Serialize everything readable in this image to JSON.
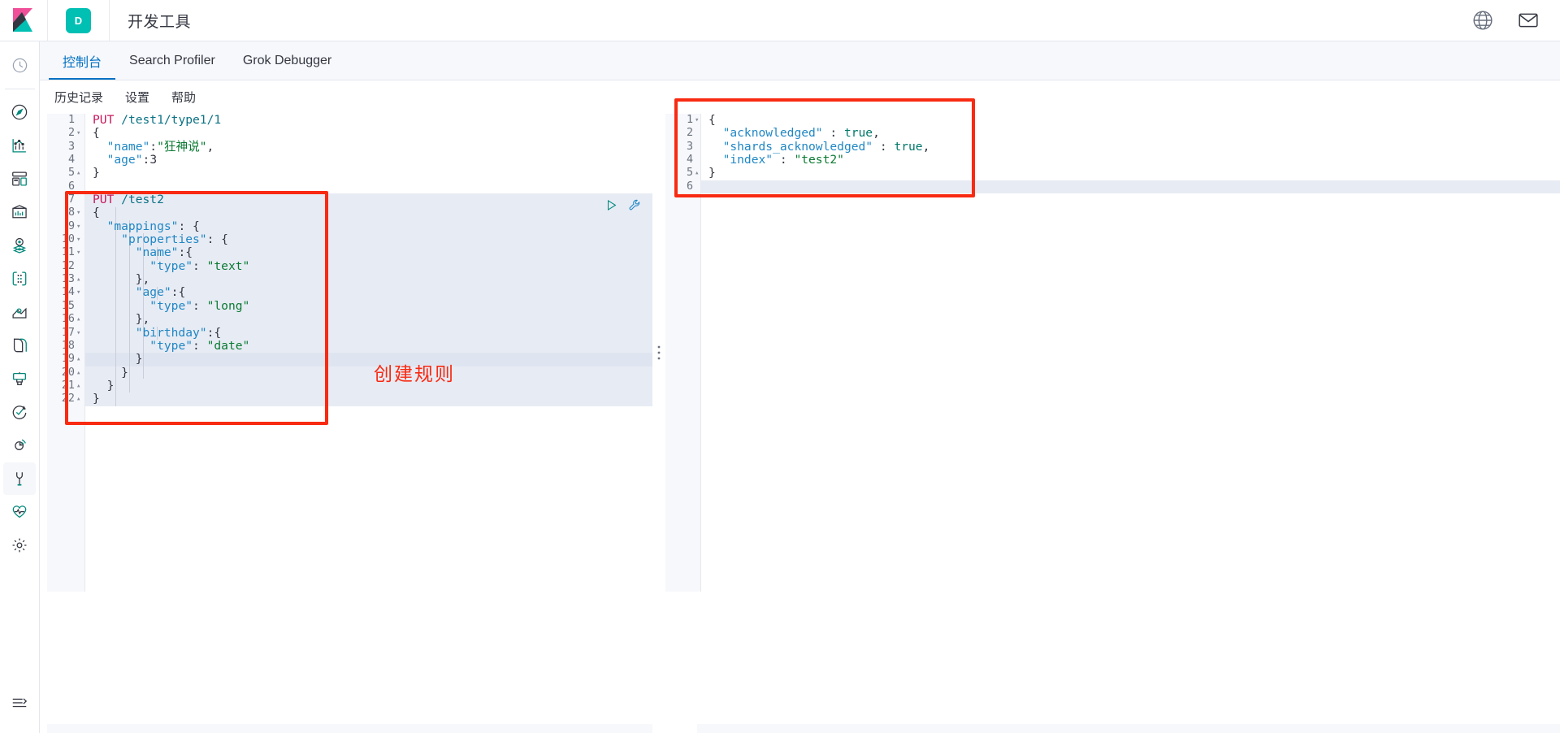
{
  "header": {
    "logo_name": "kibana-logo",
    "space_badge": "D",
    "app_title": "开发工具",
    "icons": [
      {
        "name": "help-icon",
        "label": "help"
      },
      {
        "name": "mail-icon",
        "label": "mail"
      }
    ]
  },
  "sidebar": {
    "items": [
      {
        "name": "sidebar-item-recent",
        "icon": "clock-icon",
        "active": false
      },
      {
        "name": "sidebar-item-discover",
        "icon": "compass-icon",
        "active": false
      },
      {
        "name": "sidebar-item-visualize",
        "icon": "bar-chart-icon",
        "active": false
      },
      {
        "name": "sidebar-item-dashboard",
        "icon": "dashboard-icon",
        "active": false
      },
      {
        "name": "sidebar-item-canvas",
        "icon": "canvas-icon",
        "active": false
      },
      {
        "name": "sidebar-item-maps",
        "icon": "map-pin-layers-icon",
        "active": false
      },
      {
        "name": "sidebar-item-machine-learning",
        "icon": "graph-nodes-icon",
        "active": false
      },
      {
        "name": "sidebar-item-infrastructure",
        "icon": "infrastructure-icon",
        "active": false
      },
      {
        "name": "sidebar-item-logs",
        "icon": "logs-icon",
        "active": false
      },
      {
        "name": "sidebar-item-apm",
        "icon": "apm-icon",
        "active": false
      },
      {
        "name": "sidebar-item-uptime",
        "icon": "uptime-check-icon",
        "active": false
      },
      {
        "name": "sidebar-item-siem",
        "icon": "siem-radar-icon",
        "active": false
      },
      {
        "name": "sidebar-item-dev-tools",
        "icon": "wrench-icon",
        "active": true
      },
      {
        "name": "sidebar-item-monitoring",
        "icon": "heartbeat-icon",
        "active": false
      },
      {
        "name": "sidebar-item-management",
        "icon": "gear-icon",
        "active": false
      }
    ],
    "collapse": {
      "name": "collapse-nav-icon",
      "icon": "arrow-right-bar-icon"
    }
  },
  "tabs": [
    {
      "label": "控制台",
      "active": true
    },
    {
      "label": "Search Profiler",
      "active": false
    },
    {
      "label": "Grok Debugger",
      "active": false
    }
  ],
  "console_menu": [
    {
      "label": "历史记录"
    },
    {
      "label": "设置"
    },
    {
      "label": "帮助"
    }
  ],
  "request_editor": {
    "lines": [
      {
        "no": 1,
        "fold": "",
        "tokens": [
          {
            "t": "PUT",
            "c": "t-method"
          },
          {
            "t": " ",
            "c": "t-punct"
          },
          {
            "t": "/test1/type1/1",
            "c": "t-url"
          }
        ]
      },
      {
        "no": 2,
        "fold": "▾",
        "tokens": [
          {
            "t": "{",
            "c": "t-punct"
          }
        ]
      },
      {
        "no": 3,
        "fold": "",
        "tokens": [
          {
            "t": "  ",
            "c": "t-punct"
          },
          {
            "t": "\"name\"",
            "c": "t-key"
          },
          {
            "t": ":",
            "c": "t-punct"
          },
          {
            "t": "\"狂神说\"",
            "c": "t-strg"
          },
          {
            "t": ",",
            "c": "t-punct"
          }
        ]
      },
      {
        "no": 4,
        "fold": "",
        "tokens": [
          {
            "t": "  ",
            "c": "t-punct"
          },
          {
            "t": "\"age\"",
            "c": "t-key"
          },
          {
            "t": ":",
            "c": "t-punct"
          },
          {
            "t": "3",
            "c": "t-num"
          }
        ]
      },
      {
        "no": 5,
        "fold": "▴",
        "tokens": [
          {
            "t": "}",
            "c": "t-punct"
          }
        ]
      },
      {
        "no": 6,
        "fold": "",
        "tokens": [
          {
            "t": "",
            "c": "t-punct"
          }
        ]
      },
      {
        "no": 7,
        "fold": "",
        "tokens": [
          {
            "t": "PUT",
            "c": "t-method"
          },
          {
            "t": " ",
            "c": "t-punct"
          },
          {
            "t": "/test2",
            "c": "t-url"
          }
        ]
      },
      {
        "no": 8,
        "fold": "▾",
        "tokens": [
          {
            "t": "{",
            "c": "t-punct"
          }
        ]
      },
      {
        "no": 9,
        "fold": "▾",
        "tokens": [
          {
            "t": "  ",
            "c": "t-punct"
          },
          {
            "t": "\"mappings\"",
            "c": "t-key"
          },
          {
            "t": ": {",
            "c": "t-punct"
          }
        ]
      },
      {
        "no": 10,
        "fold": "▾",
        "tokens": [
          {
            "t": "    ",
            "c": "t-punct"
          },
          {
            "t": "\"properties\"",
            "c": "t-key"
          },
          {
            "t": ": {",
            "c": "t-punct"
          }
        ]
      },
      {
        "no": 11,
        "fold": "▾",
        "tokens": [
          {
            "t": "      ",
            "c": "t-punct"
          },
          {
            "t": "\"name\"",
            "c": "t-key"
          },
          {
            "t": ":{",
            "c": "t-punct"
          }
        ]
      },
      {
        "no": 12,
        "fold": "",
        "tokens": [
          {
            "t": "        ",
            "c": "t-punct"
          },
          {
            "t": "\"type\"",
            "c": "t-key"
          },
          {
            "t": ": ",
            "c": "t-punct"
          },
          {
            "t": "\"text\"",
            "c": "t-strg"
          }
        ]
      },
      {
        "no": 13,
        "fold": "▴",
        "tokens": [
          {
            "t": "      ",
            "c": "t-punct"
          },
          {
            "t": "},",
            "c": "t-punct"
          }
        ]
      },
      {
        "no": 14,
        "fold": "▾",
        "tokens": [
          {
            "t": "      ",
            "c": "t-punct"
          },
          {
            "t": "\"age\"",
            "c": "t-key"
          },
          {
            "t": ":{",
            "c": "t-punct"
          }
        ]
      },
      {
        "no": 15,
        "fold": "",
        "tokens": [
          {
            "t": "        ",
            "c": "t-punct"
          },
          {
            "t": "\"type\"",
            "c": "t-key"
          },
          {
            "t": ": ",
            "c": "t-punct"
          },
          {
            "t": "\"long\"",
            "c": "t-strg"
          }
        ]
      },
      {
        "no": 16,
        "fold": "▴",
        "tokens": [
          {
            "t": "      ",
            "c": "t-punct"
          },
          {
            "t": "},",
            "c": "t-punct"
          }
        ]
      },
      {
        "no": 17,
        "fold": "▾",
        "tokens": [
          {
            "t": "      ",
            "c": "t-punct"
          },
          {
            "t": "\"birthday\"",
            "c": "t-key"
          },
          {
            "t": ":{",
            "c": "t-punct"
          }
        ]
      },
      {
        "no": 18,
        "fold": "",
        "tokens": [
          {
            "t": "        ",
            "c": "t-punct"
          },
          {
            "t": "\"type\"",
            "c": "t-key"
          },
          {
            "t": ": ",
            "c": "t-punct"
          },
          {
            "t": "\"date\"",
            "c": "t-strg"
          }
        ]
      },
      {
        "no": 19,
        "fold": "▴",
        "tokens": [
          {
            "t": "      ",
            "c": "t-punct"
          },
          {
            "t": "}",
            "c": "t-punct"
          }
        ]
      },
      {
        "no": 20,
        "fold": "▴",
        "tokens": [
          {
            "t": "    ",
            "c": "t-punct"
          },
          {
            "t": "}",
            "c": "t-punct"
          }
        ]
      },
      {
        "no": 21,
        "fold": "▴",
        "tokens": [
          {
            "t": "  ",
            "c": "t-punct"
          },
          {
            "t": "}",
            "c": "t-punct"
          }
        ]
      },
      {
        "no": 22,
        "fold": "▴",
        "tokens": [
          {
            "t": "}",
            "c": "t-punct"
          }
        ]
      }
    ],
    "actions": [
      {
        "name": "send-request-button",
        "icon": "play-icon"
      },
      {
        "name": "request-options-button",
        "icon": "wrench-icon"
      }
    ]
  },
  "response_editor": {
    "lines": [
      {
        "no": 1,
        "fold": "▾",
        "tokens": [
          {
            "t": "{",
            "c": "t-punct"
          }
        ]
      },
      {
        "no": 2,
        "fold": "",
        "tokens": [
          {
            "t": "  ",
            "c": "t-punct"
          },
          {
            "t": "\"acknowledged\"",
            "c": "t-key"
          },
          {
            "t": " : ",
            "c": "t-punct"
          },
          {
            "t": "true",
            "c": "t-bool"
          },
          {
            "t": ",",
            "c": "t-punct"
          }
        ]
      },
      {
        "no": 3,
        "fold": "",
        "tokens": [
          {
            "t": "  ",
            "c": "t-punct"
          },
          {
            "t": "\"shards_acknowledged\"",
            "c": "t-key"
          },
          {
            "t": " : ",
            "c": "t-punct"
          },
          {
            "t": "true",
            "c": "t-bool"
          },
          {
            "t": ",",
            "c": "t-punct"
          }
        ]
      },
      {
        "no": 4,
        "fold": "",
        "tokens": [
          {
            "t": "  ",
            "c": "t-punct"
          },
          {
            "t": "\"index\"",
            "c": "t-key"
          },
          {
            "t": " : ",
            "c": "t-punct"
          },
          {
            "t": "\"test2\"",
            "c": "t-strg"
          }
        ]
      },
      {
        "no": 5,
        "fold": "▴",
        "tokens": [
          {
            "t": "}",
            "c": "t-punct"
          }
        ]
      },
      {
        "no": 6,
        "fold": "",
        "tokens": [
          {
            "t": "",
            "c": "t-punct"
          }
        ]
      }
    ]
  },
  "annotations": {
    "color": "#f82a12",
    "label_text": "创建规则",
    "boxes": [
      {
        "name": "annotation-box-request"
      },
      {
        "name": "annotation-box-response"
      }
    ]
  }
}
